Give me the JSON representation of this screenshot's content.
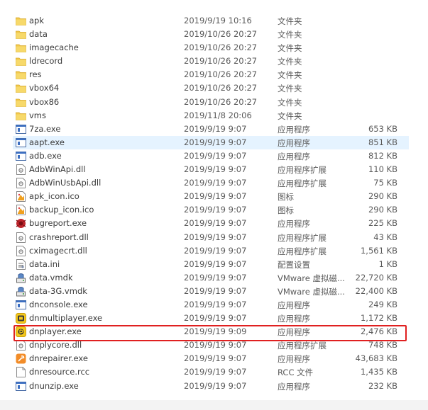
{
  "files": [
    {
      "name": "apk",
      "date": "2019/9/19 10:16",
      "type": "文件夹",
      "size": "",
      "icon": "folder-icon"
    },
    {
      "name": "data",
      "date": "2019/10/26 20:27",
      "type": "文件夹",
      "size": "",
      "icon": "folder-icon"
    },
    {
      "name": "imagecache",
      "date": "2019/10/26 20:27",
      "type": "文件夹",
      "size": "",
      "icon": "folder-icon"
    },
    {
      "name": "ldrecord",
      "date": "2019/10/26 20:27",
      "type": "文件夹",
      "size": "",
      "icon": "folder-icon"
    },
    {
      "name": "res",
      "date": "2019/10/26 20:27",
      "type": "文件夹",
      "size": "",
      "icon": "folder-icon"
    },
    {
      "name": "vbox64",
      "date": "2019/10/26 20:27",
      "type": "文件夹",
      "size": "",
      "icon": "folder-icon"
    },
    {
      "name": "vbox86",
      "date": "2019/10/26 20:27",
      "type": "文件夹",
      "size": "",
      "icon": "folder-icon"
    },
    {
      "name": "vms",
      "date": "2019/11/8 20:06",
      "type": "文件夹",
      "size": "",
      "icon": "folder-icon"
    },
    {
      "name": "7za.exe",
      "date": "2019/9/19 9:07",
      "type": "应用程序",
      "size": "653 KB",
      "icon": "exe-icon"
    },
    {
      "name": "aapt.exe",
      "date": "2019/9/19 9:07",
      "type": "应用程序",
      "size": "851 KB",
      "icon": "exe-icon"
    },
    {
      "name": "adb.exe",
      "date": "2019/9/19 9:07",
      "type": "应用程序",
      "size": "812 KB",
      "icon": "exe-icon"
    },
    {
      "name": "AdbWinApi.dll",
      "date": "2019/9/19 9:07",
      "type": "应用程序扩展",
      "size": "110 KB",
      "icon": "dll-icon"
    },
    {
      "name": "AdbWinUsbApi.dll",
      "date": "2019/9/19 9:07",
      "type": "应用程序扩展",
      "size": "75 KB",
      "icon": "dll-icon"
    },
    {
      "name": "apk_icon.ico",
      "date": "2019/9/19 9:07",
      "type": "图标",
      "size": "290 KB",
      "icon": "ico-file-icon"
    },
    {
      "name": "backup_icon.ico",
      "date": "2019/9/19 9:07",
      "type": "图标",
      "size": "290 KB",
      "icon": "ico-file-icon"
    },
    {
      "name": "bugreport.exe",
      "date": "2019/9/19 9:07",
      "type": "应用程序",
      "size": "225 KB",
      "icon": "bug-icon"
    },
    {
      "name": "crashreport.dll",
      "date": "2019/9/19 9:07",
      "type": "应用程序扩展",
      "size": "43 KB",
      "icon": "dll-icon"
    },
    {
      "name": "cximagecrt.dll",
      "date": "2019/9/19 9:07",
      "type": "应用程序扩展",
      "size": "1,561 KB",
      "icon": "dll-icon"
    },
    {
      "name": "data.ini",
      "date": "2019/9/19 9:07",
      "type": "配置设置",
      "size": "1 KB",
      "icon": "ini-icon"
    },
    {
      "name": "data.vmdk",
      "date": "2019/9/19 9:07",
      "type": "VMware 虚拟磁...",
      "size": "22,720 KB",
      "icon": "vmdk-icon"
    },
    {
      "name": "data-3G.vmdk",
      "date": "2019/9/19 9:07",
      "type": "VMware 虚拟磁...",
      "size": "22,400 KB",
      "icon": "vmdk-icon"
    },
    {
      "name": "dnconsole.exe",
      "date": "2019/9/19 9:07",
      "type": "应用程序",
      "size": "249 KB",
      "icon": "exe-icon"
    },
    {
      "name": "dnmultiplayer.exe",
      "date": "2019/9/19 9:07",
      "type": "应用程序",
      "size": "1,172 KB",
      "icon": "multiplayer-icon"
    },
    {
      "name": "dnplayer.exe",
      "date": "2019/9/19 9:09",
      "type": "应用程序",
      "size": "2,476 KB",
      "icon": "player-icon"
    },
    {
      "name": "dnplycore.dll",
      "date": "2019/9/19 9:07",
      "type": "应用程序扩展",
      "size": "748 KB",
      "icon": "dll-icon"
    },
    {
      "name": "dnrepairer.exe",
      "date": "2019/9/19 9:07",
      "type": "应用程序",
      "size": "43,683 KB",
      "icon": "repair-icon"
    },
    {
      "name": "dnresource.rcc",
      "date": "2019/9/19 9:07",
      "type": "RCC 文件",
      "size": "1,435 KB",
      "icon": "blank-file-icon"
    },
    {
      "name": "dnunzip.exe",
      "date": "2019/9/19 9:07",
      "type": "应用程序",
      "size": "232 KB",
      "icon": "exe-icon"
    }
  ],
  "selected_row": "aapt.exe",
  "highlighted_row": "dnplayer.exe",
  "colors": {
    "selection": "#e5f3ff",
    "highlight_border": "#e02020",
    "folder": "#f2c94c"
  }
}
